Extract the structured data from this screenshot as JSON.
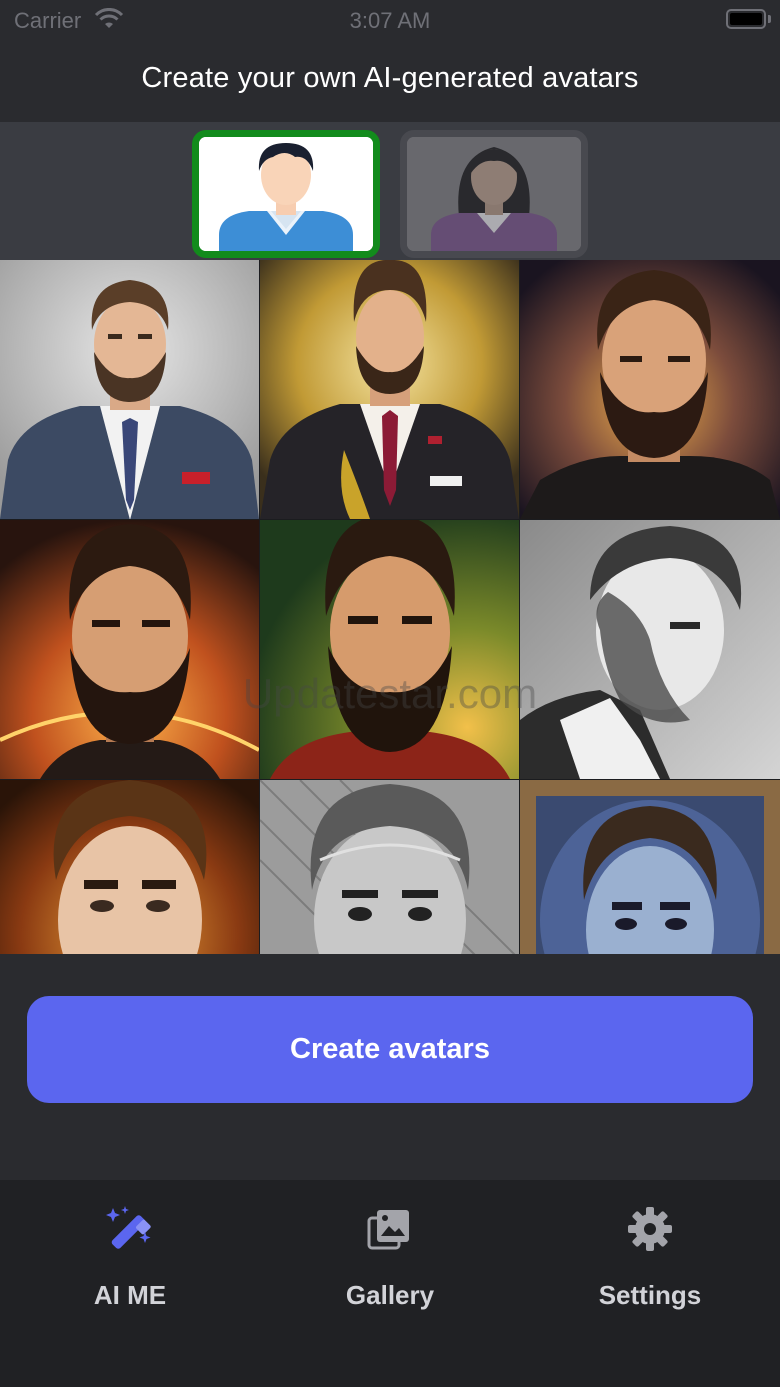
{
  "status_bar": {
    "carrier": "Carrier",
    "time": "3:07 AM",
    "icons": [
      "wifi-icon",
      "battery-icon"
    ]
  },
  "header": {
    "title": "Create your own AI-generated avatars"
  },
  "gender_selector": {
    "options": [
      {
        "id": "male",
        "icon": "male-avatar-icon",
        "selected": true
      },
      {
        "id": "female",
        "icon": "female-avatar-icon",
        "selected": false
      }
    ],
    "selected_border_color": "#128b1c"
  },
  "avatar_grid": {
    "tiles": [
      {
        "style": "business-suit-portrait"
      },
      {
        "style": "golden-suit-portrait"
      },
      {
        "style": "painted-dark-portrait"
      },
      {
        "style": "cosmic-orange-portrait"
      },
      {
        "style": "green-fiery-portrait"
      },
      {
        "style": "monochrome-sketch-portrait"
      },
      {
        "style": "fiery-close-up-portrait"
      },
      {
        "style": "engraved-grey-portrait"
      },
      {
        "style": "blue-framed-portrait"
      }
    ],
    "watermark": "Updatestar.com"
  },
  "create_button": {
    "label": "Create avatars",
    "color": "#5b66ef"
  },
  "tab_bar": {
    "active_color": "#5b66ef",
    "tabs": [
      {
        "label": "AI ME",
        "icon": "magic-wand-icon",
        "active": true
      },
      {
        "label": "Gallery",
        "icon": "gallery-icon",
        "active": false
      },
      {
        "label": "Settings",
        "icon": "gear-icon",
        "active": false
      }
    ]
  }
}
